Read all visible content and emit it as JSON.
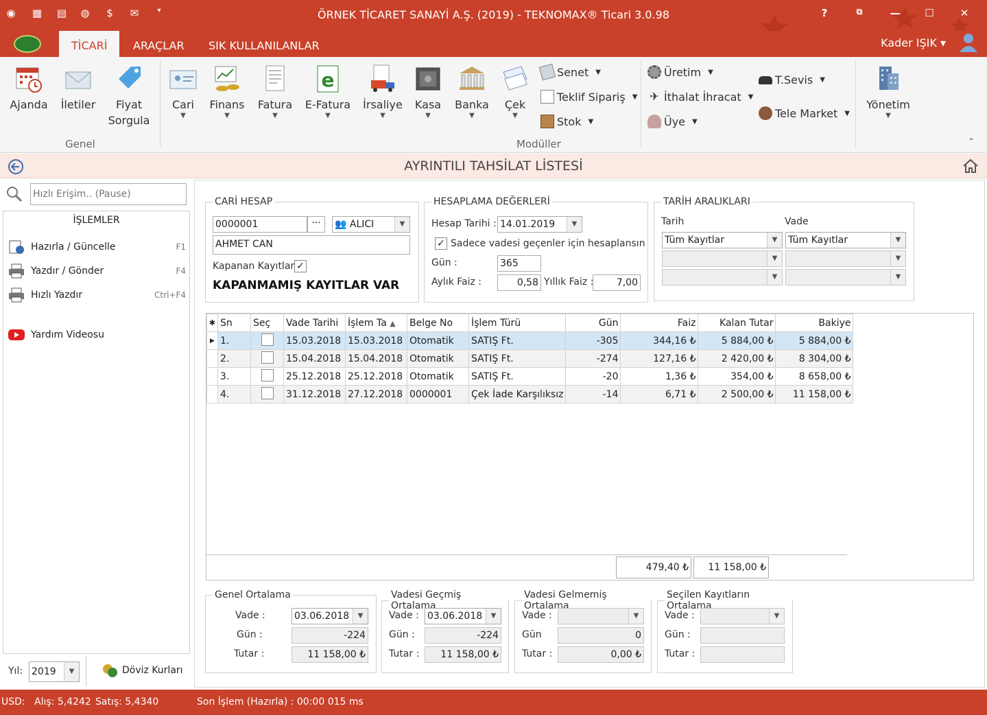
{
  "title": "ÖRNEK TİCARET SANAYİ A.Ş. (2019) - TEKNOMAX® Ticari 3.0.98",
  "tabs": [
    "TİCARİ",
    "ARAÇLAR",
    "SIK KULLANILANLAR"
  ],
  "user": "Kader IŞIK",
  "window_buttons": {
    "help": "?",
    "restore": "⧉",
    "minimize": "—",
    "maximize": "☐",
    "close": "✕"
  },
  "ribbon": {
    "genel_label": "Genel",
    "moduller_label": "Modüller",
    "ajanda": "Ajanda",
    "iletiler": "İletiler",
    "fiyat1": "Fiyat",
    "fiyat2": "Sorgula",
    "cari": "Cari",
    "finans": "Finans",
    "fatura": "Fatura",
    "efatura": "E-Fatura",
    "irsaliye": "İrsaliye",
    "kasa": "Kasa",
    "banka": "Banka",
    "cek": "Çek",
    "senet": "Senet",
    "teklif": "Teklif Sipariş",
    "stok": "Stok",
    "uretim": "Üretim",
    "ithalat": "İthalat İhracat",
    "uye": "Üye",
    "tsevis": "T.Sevis",
    "telemarket": "Tele Market",
    "yonetim": "Yönetim"
  },
  "page_title": "AYRINTILI TAHSİLAT LİSTESİ",
  "quick_access_placeholder": "Hızlı Erişim.. (Pause)",
  "left": {
    "header": "İŞLEMLER",
    "items": [
      {
        "label": "Hazırla / Güncelle",
        "key": "F1"
      },
      {
        "label": "Yazdır / Gönder",
        "key": "F4"
      },
      {
        "label": "Hızlı Yazdır",
        "key": "Ctrl+F4"
      }
    ],
    "help_video": "Yardım Videosu",
    "year_label": "Yıl:",
    "year": "2019",
    "doviz": "Döviz Kurları"
  },
  "cari": {
    "legend": "CARİ HESAP",
    "code": "0000001",
    "type": "ALICI",
    "name": "AHMET CAN",
    "closed_label": "Kapanan Kayıtlar",
    "warning": "KAPANMAMIŞ KAYITLAR VAR"
  },
  "hesap": {
    "legend": "HESAPLAMA DEĞERLERİ",
    "date_label": "Hesap Tarihi :",
    "date": "14.01.2019",
    "only_overdue": "Sadece vadesi geçenler için hesaplansın",
    "day_label": "Gün :",
    "day": "365",
    "monthly_label": "Aylık Faiz :",
    "monthly": "0,58",
    "yearly_label": "Yıllık Faiz :",
    "yearly": "7,00"
  },
  "tarih": {
    "legend": "TARİH ARALIKLARI",
    "tarih_label": "Tarih",
    "vade_label": "Vade",
    "tarih_value": "Tüm Kayıtlar",
    "vade_value": "Tüm Kayıtlar"
  },
  "grid": {
    "columns": [
      "Sn",
      "Seç",
      "Vade Tarihi",
      "İşlem Ta",
      "Belge No",
      "İşlem Türü",
      "Gün",
      "Faiz",
      "Kalan Tutar",
      "Bakiye"
    ],
    "rows": [
      {
        "sn": "1.",
        "vade": "15.03.2018",
        "islem": "15.03.2018",
        "belge": "Otomatik",
        "tur": "SATIŞ Ft.",
        "gun": "-305",
        "faiz": "344,16 ₺",
        "kalan": "5 884,00 ₺",
        "bakiye": "5 884,00 ₺"
      },
      {
        "sn": "2.",
        "vade": "15.04.2018",
        "islem": "15.04.2018",
        "belge": "Otomatik",
        "tur": "SATIŞ Ft.",
        "gun": "-274",
        "faiz": "127,16 ₺",
        "kalan": "2 420,00 ₺",
        "bakiye": "8 304,00 ₺"
      },
      {
        "sn": "3.",
        "vade": "25.12.2018",
        "islem": "25.12.2018",
        "belge": "Otomatik",
        "tur": "SATIŞ Ft.",
        "gun": "-20",
        "faiz": "1,36 ₺",
        "kalan": "354,00 ₺",
        "bakiye": "8 658,00 ₺"
      },
      {
        "sn": "4.",
        "vade": "31.12.2018",
        "islem": "27.12.2018",
        "belge": "0000001",
        "tur": "Çek İade Karşılıksız",
        "gun": "-14",
        "faiz": "6,71 ₺",
        "kalan": "2 500,00 ₺",
        "bakiye": "11 158,00 ₺"
      }
    ],
    "total_faiz": "479,40 ₺",
    "total_kalan": "11 158,00 ₺"
  },
  "averages": [
    {
      "legend": "Genel Ortalama",
      "vade_label": "Vade :",
      "gun_label": "Gün :",
      "tutar_label": "Tutar :",
      "vade": "03.06.2018",
      "gun": "-224",
      "tutar": "11 158,00 ₺"
    },
    {
      "legend": "Vadesi Geçmiş Ortalama",
      "vade_label": "Vade :",
      "gun_label": "Gün :",
      "tutar_label": "Tutar :",
      "vade": "03.06.2018",
      "gun": "-224",
      "tutar": "11 158,00 ₺"
    },
    {
      "legend": "Vadesi Gelmemiş Ortalama",
      "vade_label": "Vade :",
      "gun_label": "Gün",
      "tutar_label": "Tutar :",
      "vade": "",
      "gun": "0",
      "tutar": "0,00 ₺"
    },
    {
      "legend": "Seçilen Kayıtların Ortalama",
      "vade_label": "Vade :",
      "gun_label": "Gün :",
      "tutar_label": "Tutar :",
      "vade": "",
      "gun": "",
      "tutar": ""
    }
  ],
  "status": {
    "usd": "USD:",
    "alis": "Alış: 5,4242",
    "satis": "Satış: 5,4340",
    "last": "Son İşlem (Hazırla) : 00:00 015 ms"
  }
}
